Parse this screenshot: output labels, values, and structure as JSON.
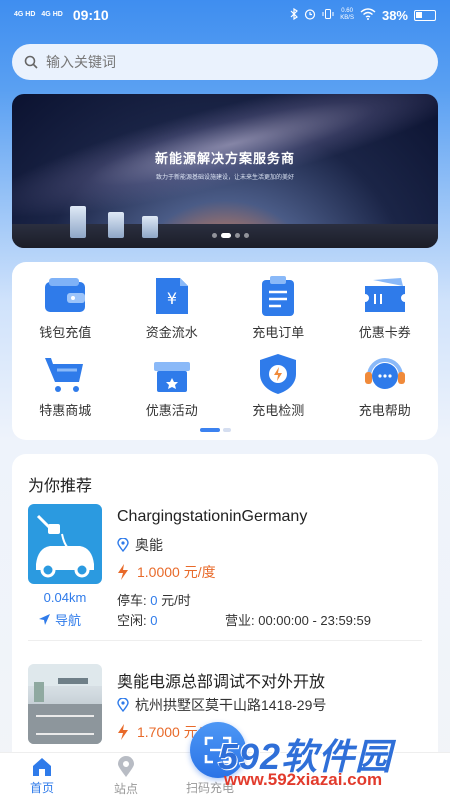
{
  "status_bar": {
    "signal1": "4G HD",
    "signal2": "4G HD",
    "time": "09:10",
    "speed_top": "0.60",
    "speed_bottom": "KB/S",
    "battery": "38%"
  },
  "search": {
    "placeholder": "输入关键词"
  },
  "banner": {
    "title": "新能源解决方案服务商",
    "subtitle": "致力于新能源基础设施建设，让未来生活更加的美好"
  },
  "grid": [
    {
      "label": "钱包充值",
      "icon": "wallet-icon"
    },
    {
      "label": "资金流水",
      "icon": "yuan-document-icon"
    },
    {
      "label": "充电订单",
      "icon": "clipboard-icon"
    },
    {
      "label": "优惠卡券",
      "icon": "ticket-icon"
    },
    {
      "label": "特惠商城",
      "icon": "shopping-cart-icon"
    },
    {
      "label": "优惠活动",
      "icon": "gift-icon"
    },
    {
      "label": "充电检测",
      "icon": "shield-bolt-icon"
    },
    {
      "label": "充电帮助",
      "icon": "headset-icon"
    }
  ],
  "recommend": {
    "title": "为你推荐",
    "stations": [
      {
        "name": "ChargingstationinGermany",
        "location": "奥能",
        "price": "1.0000 元/度",
        "distance": "0.04km",
        "nav_label": "导航",
        "parking_label": "停车:",
        "parking_value": "0",
        "parking_unit": "元/时",
        "idle_label": "空闲:",
        "idle_value": "0",
        "hours": "营业: 00:00:00 - 23:59:59"
      },
      {
        "name": "奥能电源总部调试不对外开放",
        "location": "杭州拱墅区莫干山路1418-29号",
        "price": "1.7000 元/度"
      }
    ]
  },
  "tabbar": {
    "tabs": [
      {
        "label": "首页",
        "icon": "home-icon",
        "active": true
      },
      {
        "label": "站点",
        "icon": "location-pin-icon",
        "active": false
      },
      {
        "label": "扫码充电",
        "icon": "scan-icon",
        "active": false
      }
    ]
  },
  "watermark": {
    "brand": "592软件园",
    "url": "www.592xiazai.com"
  },
  "colors": {
    "primary": "#2f7bea",
    "price": "#e86a2a"
  }
}
